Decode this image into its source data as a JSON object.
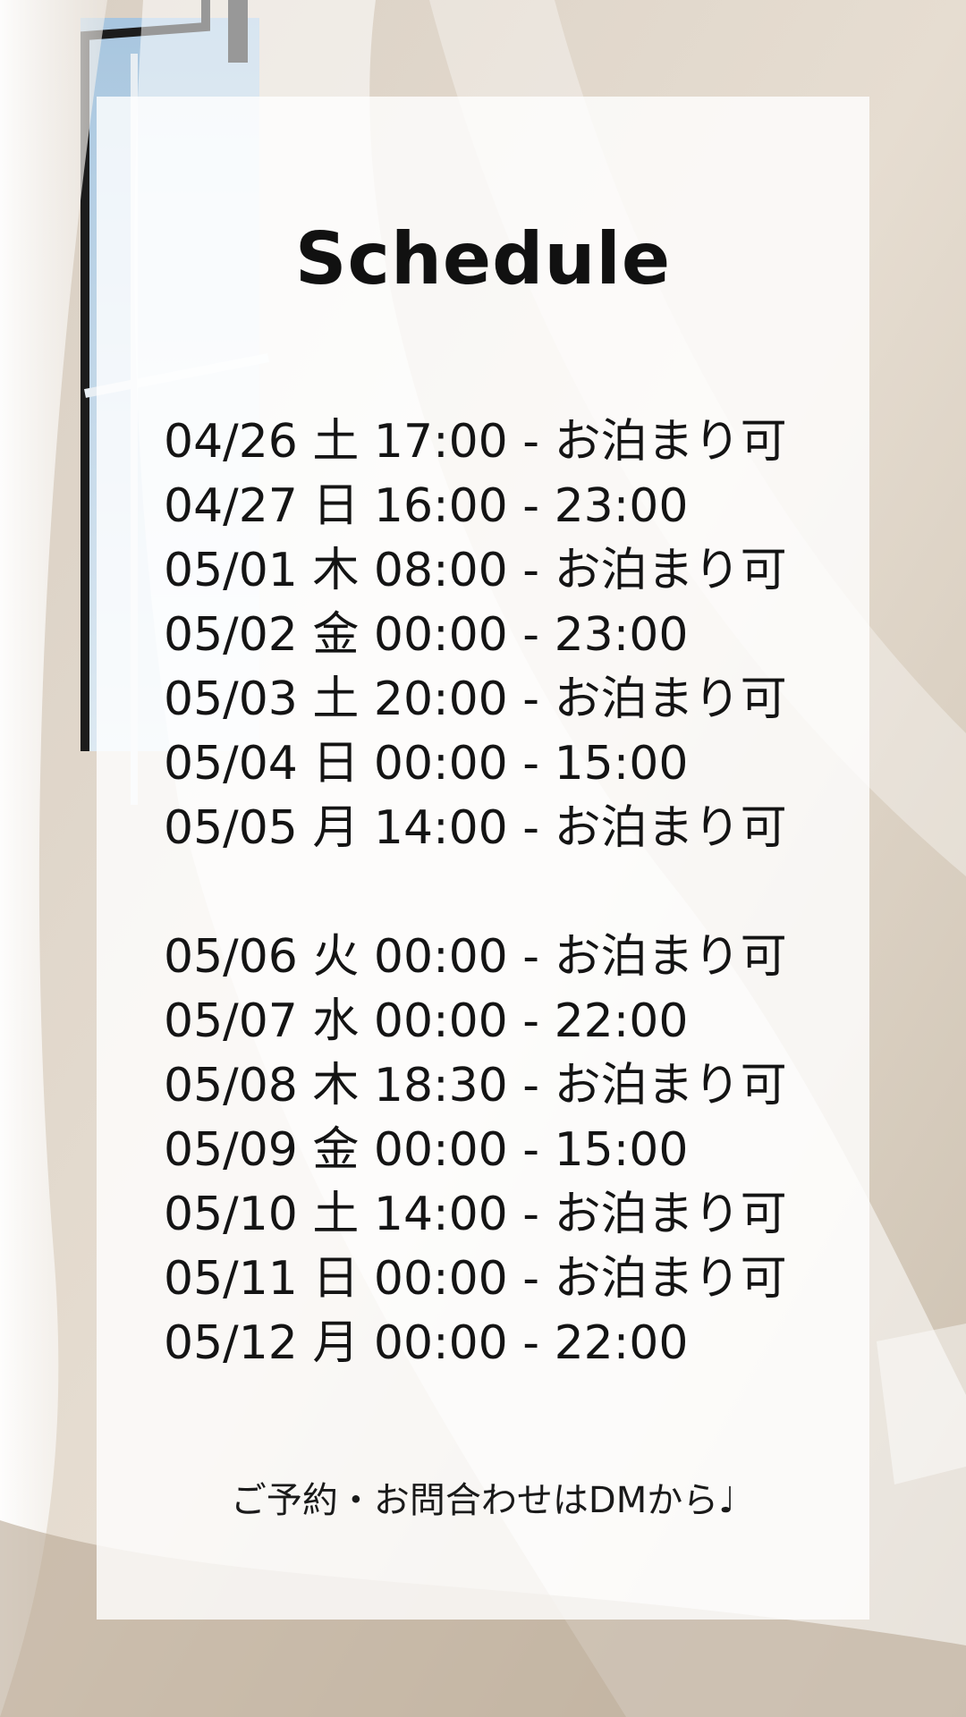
{
  "title": "Schedule",
  "schedule_block_1": [
    "04/26 土 17:00 - お泊まり可",
    "04/27 日 16:00 - 23:00",
    "05/01 木 08:00 - お泊まり可",
    "05/02 金 00:00 - 23:00",
    "05/03 土 20:00 - お泊まり可",
    "05/04 日 00:00 - 15:00",
    "05/05 月 14:00 - お泊まり可"
  ],
  "schedule_block_2": [
    "05/06 火 00:00 - お泊まり可",
    "05/07 水 00:00 - 22:00",
    "05/08 木 18:30 - お泊まり可",
    "05/09 金 00:00 - 15:00",
    "05/10 土 14:00 - お泊まり可",
    "05/11 日 00:00 - お泊まり可",
    "05/12 月 00:00 - 22:00"
  ],
  "footer_note": "ご予約・お問合わせはDMから♩"
}
